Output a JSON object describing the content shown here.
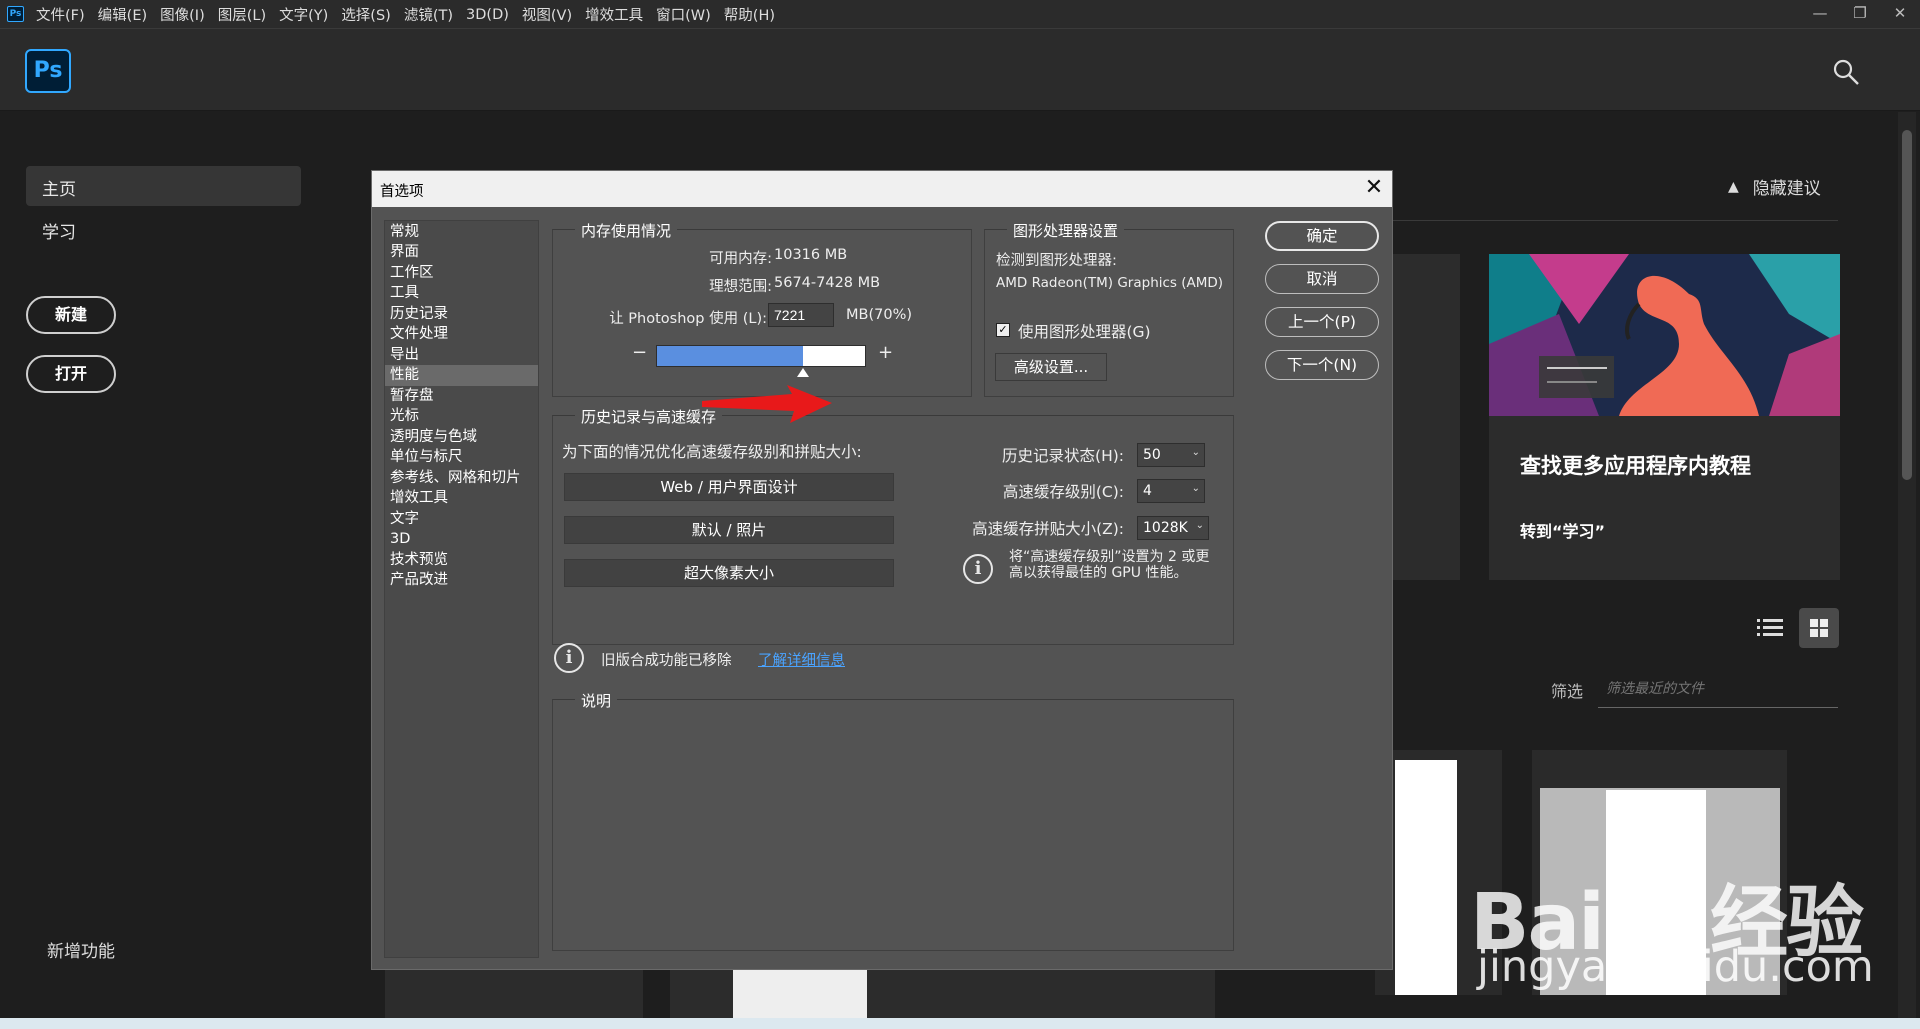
{
  "menubar": {
    "app_icon": "Ps",
    "menus": [
      "文件(F)",
      "编辑(E)",
      "图像(I)",
      "图层(L)",
      "文字(Y)",
      "选择(S)",
      "滤镜(T)",
      "3D(D)",
      "视图(V)",
      "增效工具",
      "窗口(W)",
      "帮助(H)"
    ],
    "window_controls": [
      "minimize-icon",
      "restore-icon",
      "close-icon"
    ]
  },
  "header": {
    "logo": "Ps"
  },
  "sidebar": {
    "items": [
      {
        "label": "主页"
      },
      {
        "label": "学习"
      }
    ],
    "new_label": "新建",
    "open_label": "打开",
    "whats_new": "新增功能"
  },
  "home": {
    "hide_suggestions": "隐藏建议",
    "card_title": "查找更多应用程序内教程",
    "card_link": "转到“学习”",
    "filter_label": "筛选",
    "filter_placeholder": "筛选最近的文件"
  },
  "watermark": {
    "line1": "Baidu经验",
    "line2": "jingyan.baidu.com"
  },
  "dialog": {
    "title": "首选项",
    "categories": [
      "常规",
      "界面",
      "工作区",
      "工具",
      "历史记录",
      "文件处理",
      "导出",
      "性能",
      "暂存盘",
      "光标",
      "透明度与色域",
      "单位与标尺",
      "参考线、网格和切片",
      "增效工具",
      "文字",
      "3D",
      "技术预览",
      "产品改进"
    ],
    "selected_category": "性能",
    "memory": {
      "group_label": "内存使用情况",
      "available_label": "可用内存:",
      "available_value": "10316 MB",
      "ideal_label": "理想范围:",
      "ideal_value": "5674-7428 MB",
      "use_label": "让 Photoshop 使用 (L):",
      "use_value": "7221",
      "use_unit": "MB(70%)",
      "percent": 70,
      "minus": "−",
      "plus": "+"
    },
    "gpu": {
      "group_label": "图形处理器设置",
      "detected_label": "检测到图形处理器:",
      "gpu_name": "AMD Radeon(TM) Graphics (AMD)",
      "use_gpu_label": "使用图形处理器(G)",
      "use_gpu_checked": true,
      "advanced_label": "高级设置..."
    },
    "history": {
      "group_label": "历史记录与高速缓存",
      "optimize_label": "为下面的情况优化高速缓存级别和拼贴大小:",
      "presets": [
        "Web / 用户界面设计",
        "默认 / 照片",
        "超大像素大小"
      ],
      "states_label": "历史记录状态(H):",
      "states_value": "50",
      "levels_label": "高速缓存级别(C):",
      "levels_value": "4",
      "tile_label": "高速缓存拼贴大小(Z):",
      "tile_value": "1028K",
      "tip_line1": "将“高速缓存级别”设置为 2 或更",
      "tip_line2": "高以获得最佳的 GPU 性能。"
    },
    "legacy": {
      "text": "旧版合成功能已移除",
      "link": "了解详细信息"
    },
    "description": {
      "group_label": "说明"
    },
    "buttons": {
      "ok": "确定",
      "cancel": "取消",
      "prev": "上一个(P)",
      "next": "下一个(N)"
    },
    "annotation_color": "#e8191a"
  }
}
